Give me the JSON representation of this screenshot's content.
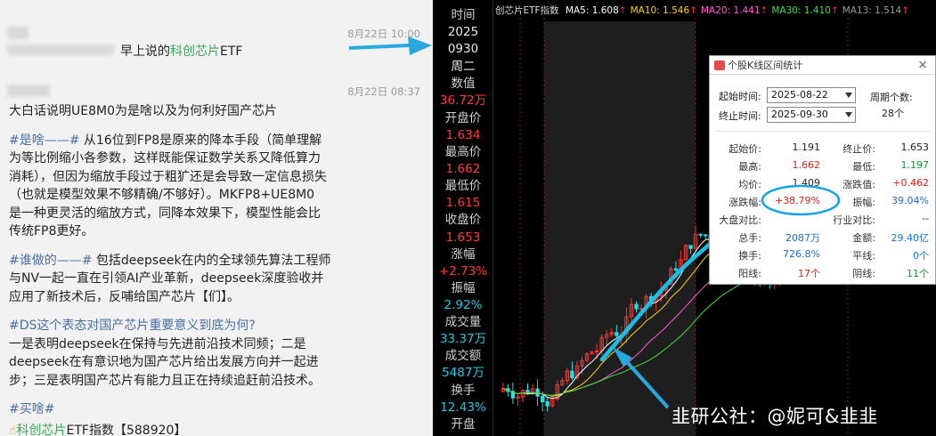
{
  "chat": {
    "msg1": {
      "timestamp": "8月22日 10:00",
      "text_prefix": "早上说的",
      "text_highlight": "科创芯片",
      "text_suffix": "ETF"
    },
    "msg2": {
      "timestamp": "8月22日 08:37",
      "lines": [
        {
          "tag": "",
          "text": "大白话说明UE8M0为是啥以及为何利好国产芯片"
        },
        {
          "tag": "",
          "text": ""
        },
        {
          "tag": "#是啥——#",
          "text": " 从16位到FP8是原来的降本手段（简单理解"
        },
        {
          "tag": "",
          "text": "为等比例缩小各参数，这样既能保证数学关系又降低算力"
        },
        {
          "tag": "",
          "text": "消耗），但因为缩放手段过于粗犷还是会导致一定信息损失"
        },
        {
          "tag": "",
          "text": "（也就是模型效果不够精确/不够好）。MKFP8+UE8M0"
        },
        {
          "tag": "",
          "text": "是一种更灵活的缩放方式，同降本效果下，模型性能会比"
        },
        {
          "tag": "",
          "text": "传统FP8更好。"
        },
        {
          "tag": "",
          "text": ""
        },
        {
          "tag": "#谁做的——#",
          "text": " 包括deepseek在内的全球领先算法工程师"
        },
        {
          "tag": "",
          "text": "与NV一起一直在引领AI产业革新，deepseek深度验收并"
        },
        {
          "tag": "",
          "text": "应用了新技术后，反哺给国产芯片【们】。"
        },
        {
          "tag": "",
          "text": ""
        },
        {
          "tag": "#DS这个表态对国产芯片重要意义到底为何?",
          "text": ""
        },
        {
          "tag": "",
          "text": "一是表明deepseek在保持与先进前沿技术同频；二是"
        },
        {
          "tag": "",
          "text": "deepseek在有意识地为国产芯片给出发展方向并一起进"
        },
        {
          "tag": "",
          "text": "步；三是表明国产芯片有能力且正在持续追赶前沿技术。"
        },
        {
          "tag": "",
          "text": ""
        },
        {
          "tag": "#买啥#",
          "text": ""
        }
      ],
      "last_line_highlight": "科创芯片",
      "last_line_suffix": "ETF指数【588920】"
    }
  },
  "sidebar": {
    "items": [
      {
        "text": "时间",
        "cls": "sb-l"
      },
      {
        "text": "2025",
        "cls": "sb-w"
      },
      {
        "text": "0930",
        "cls": "sb-w"
      },
      {
        "text": "周二",
        "cls": "sb-w"
      },
      {
        "text": "数值",
        "cls": "sb-l"
      },
      {
        "text": "36.72万",
        "cls": "sb-r"
      },
      {
        "text": "开盘价",
        "cls": "sb-l"
      },
      {
        "text": "1.634",
        "cls": "sb-r"
      },
      {
        "text": "最高价",
        "cls": "sb-l"
      },
      {
        "text": "1.662",
        "cls": "sb-r"
      },
      {
        "text": "最低价",
        "cls": "sb-l"
      },
      {
        "text": "1.615",
        "cls": "sb-r"
      },
      {
        "text": "收盘价",
        "cls": "sb-l"
      },
      {
        "text": "1.653",
        "cls": "sb-r"
      },
      {
        "text": "涨幅",
        "cls": "sb-l"
      },
      {
        "text": "+2.73%",
        "cls": "sb-r"
      },
      {
        "text": "振幅",
        "cls": "sb-l"
      },
      {
        "text": "2.92%",
        "cls": "sb-c"
      },
      {
        "text": "成交量",
        "cls": "sb-l"
      },
      {
        "text": "33.37万",
        "cls": "sb-c"
      },
      {
        "text": "成交额",
        "cls": "sb-l"
      },
      {
        "text": "5487万",
        "cls": "sb-c"
      },
      {
        "text": "换手",
        "cls": "sb-l"
      },
      {
        "text": "12.43%",
        "cls": "sb-c"
      },
      {
        "text": "开盘",
        "cls": "sb-l"
      }
    ]
  },
  "ma_bar": {
    "name": "创芯片ETF指数",
    "items": [
      {
        "label": "MA5: 1.608",
        "color": "#ffffff"
      },
      {
        "label": "MA10: 1.546",
        "color": "#ffd400"
      },
      {
        "label": "MA20: 1.441",
        "color": "#ff5ad0"
      },
      {
        "label": "MA30: 1.410",
        "color": "#3fe03f"
      },
      {
        "label": "MA13: 1.514",
        "color": "#9a9a9a"
      }
    ]
  },
  "chart": {
    "high_label": "1.662",
    "colors": {
      "up": "#ff3030",
      "down": "#21e0e8",
      "ma5": "#ffffff",
      "ma10": "#ffd400",
      "ma20": "#ff5ad0",
      "ma30": "#3fe03f"
    }
  },
  "chart_data": {
    "type": "candlestick",
    "title": "创芯片ETF指数",
    "series_count": 86,
    "last": {
      "open": 1.634,
      "high": 1.662,
      "low": 1.615,
      "close": 1.653
    },
    "interval": {
      "start": "2025-08-22",
      "end": "2025-09-30",
      "change_pct": 38.79
    }
  },
  "stats_dialog": {
    "title": "个股K线区间统计",
    "close": "×",
    "start_label": "起始时间:",
    "start_value": "2025-08-22",
    "end_label": "终止时间:",
    "end_value": "2025-09-30",
    "cycles_label": "周期个数:",
    "cycles_value": "28个",
    "rows": [
      {
        "l1": "起始价:",
        "v1": "1.191",
        "c1": "k",
        "l2": "终止价:",
        "v2": "1.653",
        "c2": "k"
      },
      {
        "l1": "最高:",
        "v1": "1.662",
        "c1": "r",
        "l2": "最低:",
        "v2": "1.197",
        "c2": "g"
      },
      {
        "l1": "均价:",
        "v1": "1.409",
        "c1": "k",
        "l2": "涨跌值:",
        "v2": "+0.462",
        "c2": "r"
      },
      {
        "l1": "涨跌幅:",
        "v1": "+38.79%",
        "c1": "r",
        "l2": "振幅:",
        "v2": "39.04%",
        "c2": "b"
      },
      {
        "l1": "大盘对比:",
        "v1": "",
        "c1": "k",
        "l2": "行业对比:",
        "v2": "--",
        "c2": "k"
      },
      {
        "l1": "总手:",
        "v1": "2087万",
        "c1": "b",
        "l2": "金额:",
        "v2": "29.40亿",
        "c2": "b"
      },
      {
        "l1": "换手:",
        "v1": "726.8%",
        "c1": "b",
        "l2": "平线:",
        "v2": "0个",
        "c2": "b"
      },
      {
        "l1": "阳线:",
        "v1": "17个",
        "c1": "r",
        "l2": "阴线:",
        "v2": "11个",
        "c2": "g"
      }
    ]
  },
  "watermark": "韭研公社：@妮可&韭韭"
}
